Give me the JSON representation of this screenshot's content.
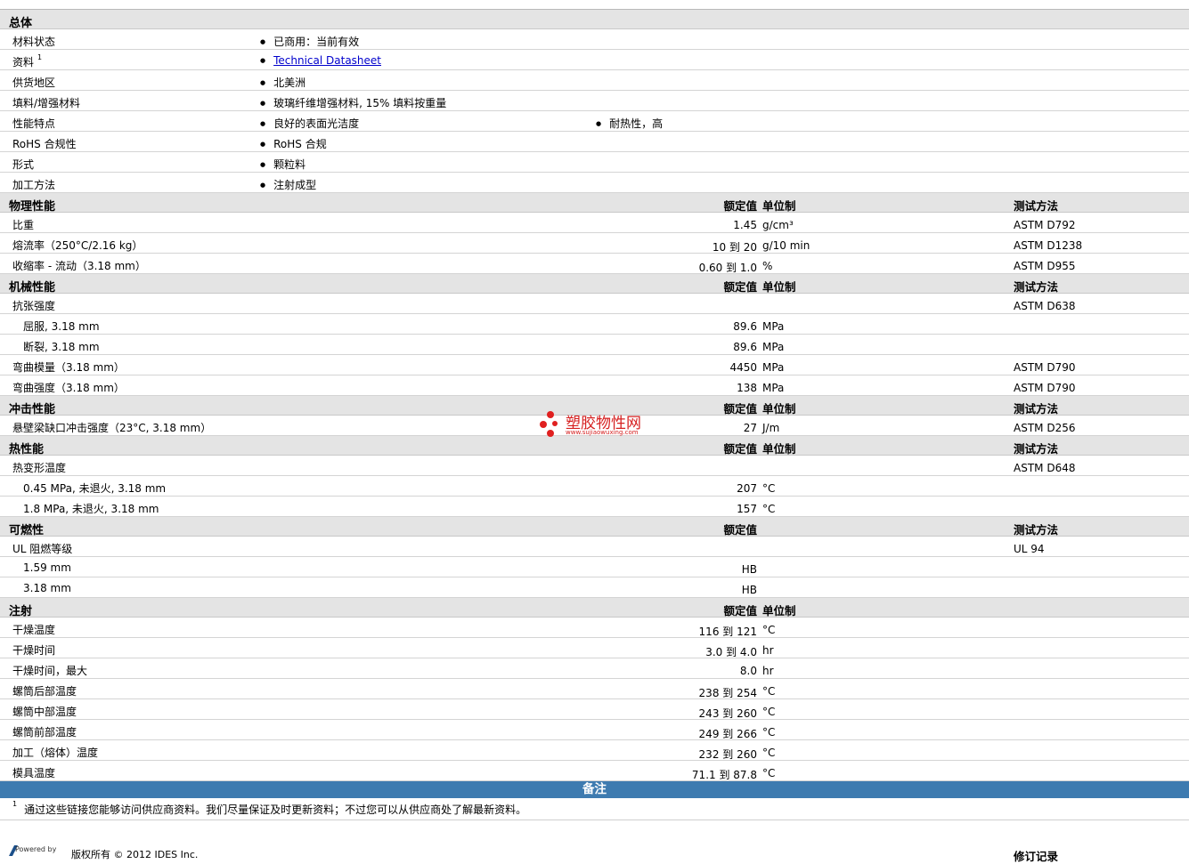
{
  "general": {
    "title": "总体",
    "rows": [
      {
        "label": "材料状态",
        "sup": "",
        "values": [
          "已商用：当前有效"
        ]
      },
      {
        "label": "资料",
        "sup": "1",
        "link": "Technical Datasheet",
        "values": []
      },
      {
        "label": "供货地区",
        "sup": "",
        "values": [
          "北美洲"
        ]
      },
      {
        "label": "填料/增强材料",
        "sup": "",
        "values": [
          "玻璃纤维增强材料, 15% 填料按重量"
        ]
      },
      {
        "label": "性能特点",
        "sup": "",
        "values": [
          "良好的表面光洁度",
          "耐热性，高"
        ]
      },
      {
        "label": "RoHS 合规性",
        "sup": "",
        "values": [
          "RoHS 合规"
        ]
      },
      {
        "label": "形式",
        "sup": "",
        "values": [
          "颗粒料"
        ]
      },
      {
        "label": "加工方法",
        "sup": "",
        "values": [
          "注射成型"
        ]
      }
    ]
  },
  "sections": [
    {
      "title": "物理性能",
      "h_value": "额定值",
      "h_unit": "单位制",
      "h_test": "测试方法",
      "rows": [
        {
          "label": "比重",
          "value": "1.45",
          "unit": "g/cm³",
          "test": "ASTM D792",
          "sub": false
        },
        {
          "label": "熔流率（250°C/2.16 kg）",
          "value": "10 到  20",
          "unit": "g/10 min",
          "test": "ASTM D1238",
          "sub": false
        },
        {
          "label": "收缩率 - 流动（3.18 mm）",
          "value": "0.60 到  1.0",
          "unit": "%",
          "test": "ASTM D955",
          "sub": false
        }
      ]
    },
    {
      "title": "机械性能",
      "h_value": "额定值",
      "h_unit": "单位制",
      "h_test": "测试方法",
      "rows": [
        {
          "label": "抗张强度",
          "value": "",
          "unit": "",
          "test": "ASTM D638",
          "sub": false
        },
        {
          "label": "屈服, 3.18 mm",
          "value": "89.6",
          "unit": "MPa",
          "test": "",
          "sub": true
        },
        {
          "label": "断裂, 3.18 mm",
          "value": "89.6",
          "unit": "MPa",
          "test": "",
          "sub": true
        },
        {
          "label": "弯曲模量（3.18 mm）",
          "value": "4450",
          "unit": "MPa",
          "test": "ASTM D790",
          "sub": false
        },
        {
          "label": "弯曲强度（3.18 mm）",
          "value": "138",
          "unit": "MPa",
          "test": "ASTM D790",
          "sub": false
        }
      ]
    },
    {
      "title": "冲击性能",
      "h_value": "额定值",
      "h_unit": "单位制",
      "h_test": "测试方法",
      "rows": [
        {
          "label": "悬壁梁缺口冲击强度（23°C, 3.18 mm）",
          "value": "27",
          "unit": "J/m",
          "test": "ASTM D256",
          "sub": false
        }
      ]
    },
    {
      "title": "热性能",
      "h_value": "额定值",
      "h_unit": "单位制",
      "h_test": "测试方法",
      "rows": [
        {
          "label": "热变形温度",
          "value": "",
          "unit": "",
          "test": "ASTM D648",
          "sub": false
        },
        {
          "label": "0.45 MPa, 未退火, 3.18 mm",
          "value": "207",
          "unit": "°C",
          "test": "",
          "sub": true
        },
        {
          "label": "1.8 MPa, 未退火, 3.18 mm",
          "value": "157",
          "unit": "°C",
          "test": "",
          "sub": true
        }
      ]
    },
    {
      "title": "可燃性",
      "h_value": "额定值",
      "h_unit": "",
      "h_test": "测试方法",
      "rows": [
        {
          "label": "UL 阻燃等级",
          "value": "",
          "unit": "",
          "test": "UL 94",
          "sub": false
        },
        {
          "label": "1.59 mm",
          "value": "HB",
          "unit": "",
          "test": "",
          "sub": true
        },
        {
          "label": "3.18 mm",
          "value": "HB",
          "unit": "",
          "test": "",
          "sub": true
        }
      ]
    },
    {
      "title": "注射",
      "h_value": "额定值",
      "h_unit": "单位制",
      "h_test": "",
      "rows": [
        {
          "label": "干燥温度",
          "value": "116 到  121",
          "unit": "°C",
          "test": "",
          "sub": false
        },
        {
          "label": "干燥时间",
          "value": "3.0 到  4.0",
          "unit": "hr",
          "test": "",
          "sub": false
        },
        {
          "label": "干燥时间，最大",
          "value": "8.0",
          "unit": "hr",
          "test": "",
          "sub": false
        },
        {
          "label": "螺筒后部温度",
          "value": "238 到  254",
          "unit": "°C",
          "test": "",
          "sub": false
        },
        {
          "label": "螺筒中部温度",
          "value": "243 到  260",
          "unit": "°C",
          "test": "",
          "sub": false
        },
        {
          "label": "螺筒前部温度",
          "value": "249 到  266",
          "unit": "°C",
          "test": "",
          "sub": false
        },
        {
          "label": "加工（熔体）温度",
          "value": "232 到  260",
          "unit": "°C",
          "test": "",
          "sub": false
        },
        {
          "label": "模具温度",
          "value": "71.1 到  87.8",
          "unit": "°C",
          "test": "",
          "sub": false
        }
      ]
    }
  ],
  "notes": {
    "title": "备注",
    "footnote_num": "1",
    "footnote": "通过这些链接您能够访问供应商资料。我们尽量保证及时更新资料；不过您可以从供应商处了解最新资料。"
  },
  "footer": {
    "powered_by": "Powered by",
    "copyright": "版权所有 © 2012 IDES Inc.",
    "revision": "修订记录"
  },
  "watermark": {
    "text": "塑胶物性网",
    "url": "www.sujiaowuxing.com"
  },
  "colors": {
    "section_bg": "#e4e4e4",
    "notes_bar": "#3e7bb0",
    "link": "#0000cc",
    "watermark": "#d62020"
  }
}
